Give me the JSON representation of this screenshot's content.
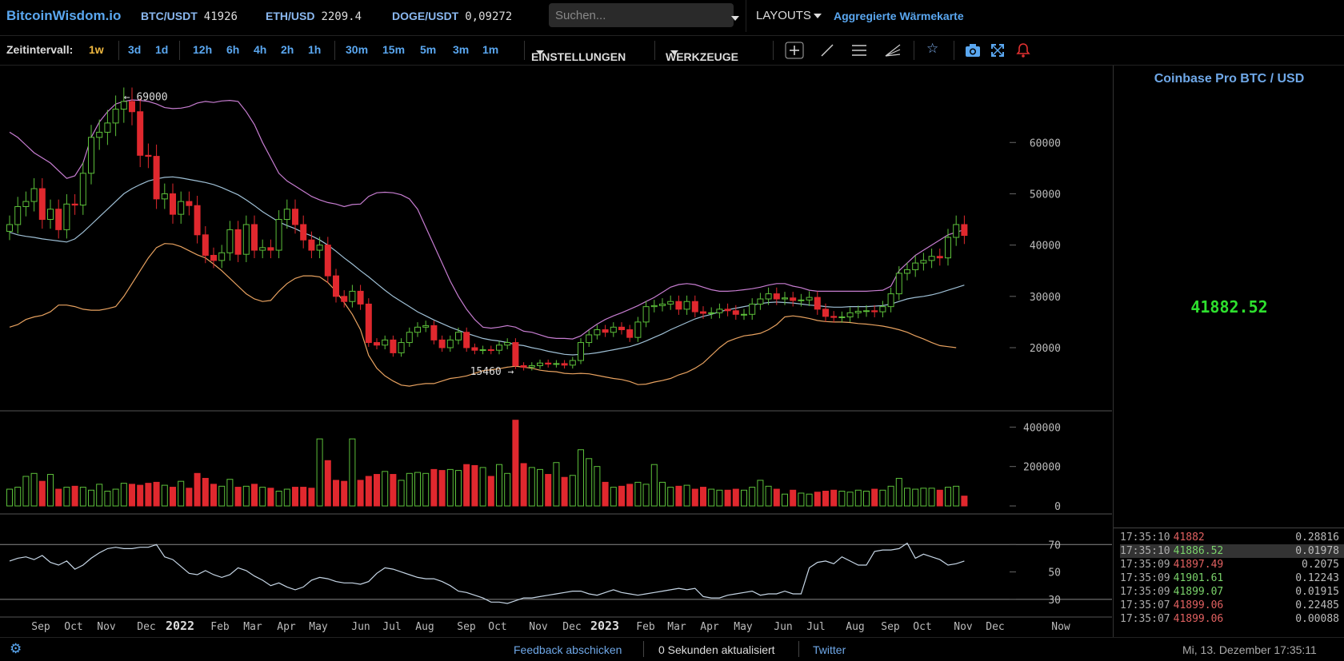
{
  "header": {
    "logo": "BitcoinWisdom.io",
    "tickers": [
      {
        "symbol": "BTC/USDT",
        "value": "41926"
      },
      {
        "symbol": "ETH/USD",
        "value": "2209.4"
      },
      {
        "symbol": "DOGE/USDT",
        "value": "0,09272"
      }
    ],
    "search_placeholder": "Suchen...",
    "layouts_label": "LAYOUTS",
    "heatmap_link": "Aggregierte Wärmekarte"
  },
  "toolbar": {
    "interval_label": "Zeitintervall:",
    "intervals": [
      "1w",
      "3d",
      "1d",
      "12h",
      "6h",
      "4h",
      "2h",
      "1h",
      "30m",
      "15m",
      "5m",
      "3m",
      "1m"
    ],
    "active_interval": "1w",
    "settings_label": "EINSTELLUNGEN",
    "tools_label": "WERKZEUGE",
    "icons": [
      "crosshair-icon",
      "trendline-icon",
      "horizontal-lines-icon",
      "fan-icon",
      "star-icon",
      "camera-icon",
      "fullscreen-icon",
      "alert-bell-icon"
    ]
  },
  "chart_data": {
    "type": "candlestick",
    "x_tick_labels": [
      "Sep",
      "Oct",
      "Nov",
      "Dec",
      "2022",
      "Feb",
      "Mar",
      "Apr",
      "May",
      "Jun",
      "Jul",
      "Aug",
      "Sep",
      "Oct",
      "Nov",
      "Dec",
      "2023",
      "Feb",
      "Mar",
      "Apr",
      "May",
      "Jun",
      "Jul",
      "Aug",
      "Sep",
      "Oct",
      "Nov",
      "Dec",
      "Now"
    ],
    "price_axis_ticks": [
      "60000",
      "50000",
      "40000",
      "30000",
      "20000"
    ],
    "price_range": [
      8000,
      75000
    ],
    "volume_axis_ticks": [
      "400000",
      "200000",
      "0"
    ],
    "volume_range": [
      0,
      450000
    ],
    "indicator_axis_ticks": [
      "70",
      "50",
      "30"
    ],
    "indicator_range": [
      20,
      90
    ],
    "annotations": [
      {
        "text": "← 69000"
      },
      {
        "text": "15460 →"
      }
    ],
    "closes": [
      44000,
      47500,
      48500,
      51000,
      45000,
      47000,
      43000,
      48000,
      47800,
      54000,
      61000,
      62000,
      63800,
      66500,
      68000,
      66000,
      57500,
      57300,
      49000,
      50000,
      46000,
      48500,
      47700,
      42000,
      38000,
      37000,
      38500,
      43000,
      38200,
      44000,
      39000,
      39500,
      39000,
      45000,
      47000,
      44000,
      41000,
      39000,
      40000,
      34000,
      30000,
      29000,
      31000,
      28500,
      21000,
      20500,
      21500,
      19000,
      21000,
      23000,
      24000,
      24300,
      21500,
      20000,
      21500,
      23000,
      20000,
      19500,
      19600,
      19500,
      20500,
      21000,
      16500,
      16200,
      16500,
      17000,
      16800,
      16900,
      16600,
      17500,
      21000,
      22500,
      23500,
      23000,
      24000,
      23500,
      22000,
      25000,
      28000,
      28200,
      28500,
      29000,
      27500,
      29000,
      27000,
      26700,
      26800,
      27500,
      27200,
      26500,
      26500,
      28500,
      29500,
      30500,
      29500,
      29700,
      29200,
      29300,
      29800,
      27500,
      26100,
      25900,
      26000,
      26800,
      27100,
      27200,
      27000,
      28000,
      30500,
      34500,
      35200,
      36500,
      37000,
      37800,
      37500,
      41500,
      44000,
      41882
    ],
    "volumes": [
      85000,
      95000,
      150000,
      165000,
      125000,
      160000,
      85000,
      95000,
      100000,
      95000,
      80000,
      110000,
      75000,
      85000,
      115000,
      110000,
      105000,
      115000,
      120000,
      105000,
      95000,
      125000,
      90000,
      165000,
      140000,
      110000,
      100000,
      135000,
      95000,
      100000,
      110000,
      95000,
      90000,
      75000,
      85000,
      95000,
      95000,
      90000,
      340000,
      230000,
      130000,
      125000,
      340000,
      130000,
      150000,
      160000,
      175000,
      160000,
      130000,
      165000,
      170000,
      165000,
      185000,
      180000,
      185000,
      180000,
      210000,
      205000,
      195000,
      150000,
      210000,
      165000,
      435000,
      215000,
      195000,
      185000,
      160000,
      220000,
      145000,
      155000,
      285000,
      240000,
      200000,
      120000,
      95000,
      100000,
      110000,
      120000,
      110000,
      210000,
      120000,
      95000,
      100000,
      105000,
      85000,
      95000,
      85000,
      80000,
      80000,
      85000,
      80000,
      95000,
      130000,
      100000,
      85000,
      60000,
      80000,
      65000,
      60000,
      70000,
      75000,
      80000,
      75000,
      70000,
      80000,
      75000,
      85000,
      80000,
      100000,
      140000,
      90000,
      85000,
      90000,
      90000,
      80000,
      95000,
      100000,
      50000
    ],
    "bollinger_upper": [
      62000,
      61000,
      59500,
      58000,
      57000,
      56000,
      54500,
      53000,
      53500,
      56000,
      61000,
      64000,
      66000,
      67500,
      68000,
      68300,
      68200,
      68000,
      67500,
      66800,
      66600,
      66700,
      67000,
      67700,
      68000,
      67800,
      68100,
      68200,
      68000,
      66000,
      63500,
      60000,
      57000,
      54000,
      52500,
      51500,
      50500,
      49500,
      48800,
      48300,
      48000,
      47500,
      47900,
      48000,
      49500,
      50200,
      50300,
      50200,
      49800,
      49000,
      47000,
      43500,
      40000,
      36500,
      33000,
      30000,
      27500,
      25500,
      24000,
      23800,
      24000,
      24300,
      24000,
      23200,
      23000,
      22500,
      22000,
      21800,
      21800,
      21700,
      22300,
      23500,
      24600,
      25500,
      26200,
      26800,
      27500,
      28200,
      29000,
      29800,
      30800,
      31800,
      32300,
      32500,
      32300,
      31800,
      31300,
      31000,
      31000,
      31100,
      31300,
      31500,
      31800,
      32200,
      32500,
      32500,
      32000,
      31700,
      31200,
      31000,
      31000,
      31000,
      31000,
      31000,
      31000,
      31000,
      31100,
      31200,
      32000,
      35000,
      36500,
      38000,
      39000,
      40000,
      41000,
      42000,
      42500,
      43000
    ],
    "bollinger_middle": [
      42500,
      42000,
      41700,
      41500,
      41200,
      41000,
      40800,
      40600,
      41200,
      42500,
      44000,
      45500,
      47000,
      48500,
      50000,
      51000,
      51800,
      52500,
      52900,
      53200,
      53300,
      53100,
      52800,
      52500,
      52200,
      51800,
      51200,
      50500,
      49800,
      48800,
      47700,
      46500,
      45500,
      44500,
      43800,
      43200,
      42400,
      41800,
      41000,
      40000,
      38800,
      37500,
      36300,
      35000,
      33800,
      32500,
      31200,
      30000,
      29000,
      28000,
      27000,
      26200,
      25400,
      24700,
      24000,
      23400,
      22800,
      22300,
      21800,
      21500,
      21300,
      21000,
      20600,
      20400,
      20000,
      19700,
      19300,
      19000,
      18700,
      18600,
      18700,
      18800,
      19000,
      19300,
      19600,
      19900,
      20200,
      20700,
      21300,
      22000,
      22700,
      23500,
      24200,
      24900,
      25600,
      26100,
      26500,
      27000,
      27400,
      27700,
      28000,
      28300,
      28600,
      28800,
      28900,
      28800,
      28700,
      28500,
      28300,
      28200,
      28000,
      27900,
      27900,
      28000,
      28000,
      28000,
      28100,
      28200,
      28500,
      29000,
      29500,
      29800,
      30000,
      30300,
      30700,
      31200,
      31700,
      32200
    ],
    "bollinger_lower": [
      24000,
      24500,
      25500,
      26000,
      26300,
      27000,
      28300,
      28300,
      28000,
      27500,
      27300,
      27300,
      27600,
      28000,
      30000,
      32500,
      35000,
      37500,
      39500,
      40300,
      40200,
      39700,
      38900,
      38100,
      37500,
      36300,
      35000,
      33500,
      32000,
      30500,
      29500,
      29000,
      29200,
      31000,
      32500,
      33500,
      34000,
      34000,
      33800,
      32700,
      31000,
      28800,
      26500,
      23500,
      18500,
      16000,
      14500,
      13500,
      12700,
      12500,
      12800,
      13000,
      13000,
      13500,
      14000,
      14200,
      14500,
      15000,
      15500,
      15700,
      15900,
      16200,
      16400,
      16200,
      16000,
      15600,
      15400,
      15300,
      15000,
      14900,
      15000,
      14900,
      14600,
      14300,
      14000,
      13800,
      13400,
      12800,
      12900,
      13300,
      13600,
      14000,
      14700,
      15200,
      16000,
      17000,
      18500,
      20000,
      21200,
      21800,
      22300,
      22500,
      22800,
      23500,
      24500,
      26000,
      26200,
      26000,
      25700,
      25300,
      25100,
      25000,
      25000,
      24900,
      24700,
      24600,
      24400,
      24200,
      23900,
      23500,
      23000,
      22300,
      21700,
      21000,
      20400,
      20200,
      20000
    ],
    "indicator": [
      58,
      60,
      61,
      59,
      62,
      57,
      55,
      58,
      52,
      55,
      60,
      64,
      67,
      68,
      67,
      67,
      68,
      68,
      70,
      61,
      59,
      54,
      49,
      48,
      51,
      48,
      46,
      48,
      53,
      51,
      47,
      44,
      40,
      42,
      39,
      37,
      39,
      44,
      46,
      45,
      43,
      42,
      42,
      41,
      43,
      49,
      53,
      52,
      50,
      48,
      46,
      45,
      45,
      43,
      40,
      36,
      35,
      33,
      31,
      28,
      28,
      27,
      29,
      31,
      31,
      32,
      33,
      34,
      35,
      36,
      36,
      34,
      33,
      35,
      37,
      35,
      34,
      33,
      34,
      35,
      36,
      37,
      38,
      37,
      38,
      32,
      31,
      31,
      33,
      34,
      35,
      36,
      33,
      34,
      34,
      36,
      34,
      34,
      53,
      57,
      58,
      56,
      61,
      58,
      55,
      55,
      65,
      66,
      66,
      67,
      71,
      60,
      63,
      61,
      59,
      55,
      56,
      58
    ]
  },
  "sidebar": {
    "title": "Coinbase Pro BTC / USD",
    "last_price": "41882.52",
    "trades": [
      {
        "time": "17:35:10",
        "price": "41882",
        "amount": "0.28816",
        "side": "sell"
      },
      {
        "time": "17:35:10",
        "price": "41886.52",
        "amount": "0.01978",
        "side": "buy",
        "highlight": true
      },
      {
        "time": "17:35:09",
        "price": "41897.49",
        "amount": "0.2075",
        "side": "sell"
      },
      {
        "time": "17:35:09",
        "price": "41901.61",
        "amount": "0.12243",
        "side": "buy"
      },
      {
        "time": "17:35:09",
        "price": "41899.07",
        "amount": "0.01915",
        "side": "buy"
      },
      {
        "time": "17:35:07",
        "price": "41899.06",
        "amount": "0.22485",
        "side": "sell"
      },
      {
        "time": "17:35:07",
        "price": "41899.06",
        "amount": "0.00088",
        "side": "sell"
      }
    ]
  },
  "footer": {
    "feedback": "Feedback abschicken",
    "updated": "0 Sekunden aktualisiert",
    "twitter": "Twitter",
    "datetime": "Mi, 13. Dezember 17:35:11"
  },
  "colors": {
    "up": "#5cbf3a",
    "down": "#e0282e",
    "upper_band": "#c77dd1",
    "middle_band": "#9fc0d6",
    "lower_band": "#e8a260",
    "accent": "#5aa7f0",
    "active_interval": "#f0b840"
  }
}
